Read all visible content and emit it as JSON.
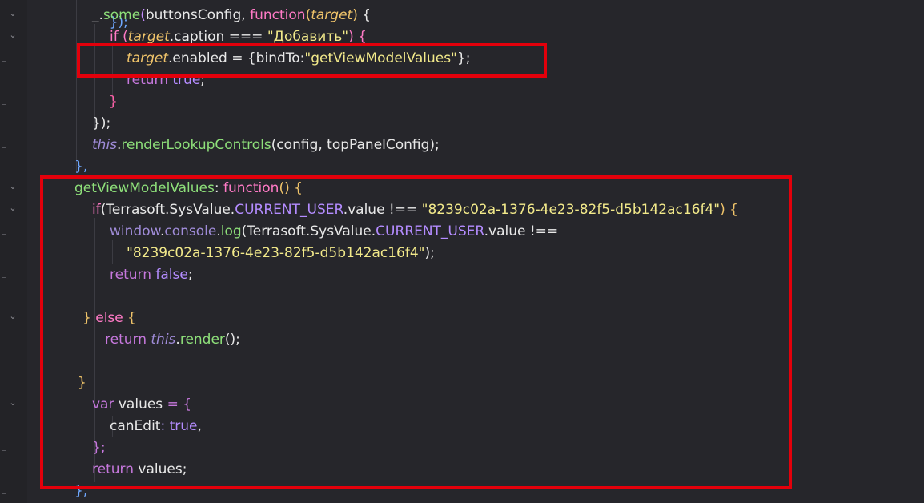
{
  "lines": [
    {
      "id": "l0",
      "t": "});"
    },
    {
      "id": "l1a",
      "t": "_."
    },
    {
      "id": "l1b",
      "t": "some"
    },
    {
      "id": "l1c",
      "t": "(buttonsConfig, "
    },
    {
      "id": "l1d",
      "t": "function"
    },
    {
      "id": "l1e",
      "t": "("
    },
    {
      "id": "l1f",
      "t": "target"
    },
    {
      "id": "l1g",
      "t": ") {"
    },
    {
      "id": "l2a",
      "t": "if ("
    },
    {
      "id": "l2b",
      "t": "target"
    },
    {
      "id": "l2c",
      "t": ".caption === "
    },
    {
      "id": "l2d",
      "t": "\"Добавить\""
    },
    {
      "id": "l2e",
      "t": ") {"
    },
    {
      "id": "l3a",
      "t": "target"
    },
    {
      "id": "l3b",
      "t": ".enabled = {bindTo:"
    },
    {
      "id": "l3c",
      "t": "\"getViewModelValues\""
    },
    {
      "id": "l3d",
      "t": "};"
    },
    {
      "id": "l4a",
      "t": "return "
    },
    {
      "id": "l4b",
      "t": "true"
    },
    {
      "id": "l4c",
      "t": ";"
    },
    {
      "id": "l5",
      "t": "}"
    },
    {
      "id": "l6",
      "t": "});"
    },
    {
      "id": "l7a",
      "t": "this"
    },
    {
      "id": "l7b",
      "t": "."
    },
    {
      "id": "l7c",
      "t": "renderLookupControls"
    },
    {
      "id": "l7d",
      "t": "(config, topPanelConfig);"
    },
    {
      "id": "l8",
      "t": "},"
    },
    {
      "id": "l9a",
      "t": "getViewModelValues"
    },
    {
      "id": "l9b",
      "t": ": "
    },
    {
      "id": "l9c",
      "t": "function"
    },
    {
      "id": "l9d",
      "t": "() {"
    },
    {
      "id": "l10a",
      "t": "if"
    },
    {
      "id": "l10b",
      "t": "(Terrasoft.SysValue."
    },
    {
      "id": "l10c",
      "t": "CURRENT_USER"
    },
    {
      "id": "l10d",
      "t": ".value !== "
    },
    {
      "id": "l10e",
      "t": "\"8239c02a-1376-4e23-82f5-d5b142ac16f4\""
    },
    {
      "id": "l10f",
      "t": ") {"
    },
    {
      "id": "l11a",
      "t": "window"
    },
    {
      "id": "l11b",
      "t": "."
    },
    {
      "id": "l11c",
      "t": "console"
    },
    {
      "id": "l11d",
      "t": "."
    },
    {
      "id": "l11e",
      "t": "log"
    },
    {
      "id": "l11f",
      "t": "(Terrasoft.SysValue."
    },
    {
      "id": "l11g",
      "t": "CURRENT_USER"
    },
    {
      "id": "l11h",
      "t": ".value !=="
    },
    {
      "id": "l12a",
      "t": "\"8239c02a-1376-4e23-82f5-d5b142ac16f4\""
    },
    {
      "id": "l12b",
      "t": ");"
    },
    {
      "id": "l13a",
      "t": "return "
    },
    {
      "id": "l13b",
      "t": "false"
    },
    {
      "id": "l13c",
      "t": ";"
    },
    {
      "id": "l14a",
      "t": "} "
    },
    {
      "id": "l14b",
      "t": "else"
    },
    {
      "id": "l14c",
      "t": " {"
    },
    {
      "id": "l15a",
      "t": "return "
    },
    {
      "id": "l15b",
      "t": "this"
    },
    {
      "id": "l15c",
      "t": "."
    },
    {
      "id": "l15d",
      "t": "render"
    },
    {
      "id": "l15e",
      "t": "();"
    },
    {
      "id": "l16",
      "t": "}"
    },
    {
      "id": "l17a",
      "t": "var "
    },
    {
      "id": "l17b",
      "t": "values"
    },
    {
      "id": "l17c",
      "t": " = {"
    },
    {
      "id": "l18a",
      "t": "canEdit"
    },
    {
      "id": "l18b",
      "t": ": "
    },
    {
      "id": "l18c",
      "t": "true"
    },
    {
      "id": "l18d",
      "t": ","
    },
    {
      "id": "l19",
      "t": "};"
    },
    {
      "id": "l20a",
      "t": "return "
    },
    {
      "id": "l20b",
      "t": "values"
    },
    {
      "id": "l20c",
      "t": ";"
    },
    {
      "id": "l21",
      "t": "},"
    }
  ],
  "gutter": {
    "fold_icon": "chevron-down-icon",
    "fold_glyph": "⌄"
  },
  "colors": {
    "background": "#26262b",
    "highlight_box": "#e3000b",
    "keyword": "#ff7ac6",
    "function_name": "#8ee07a",
    "string": "#f2e98a",
    "constant": "#b48cff"
  }
}
